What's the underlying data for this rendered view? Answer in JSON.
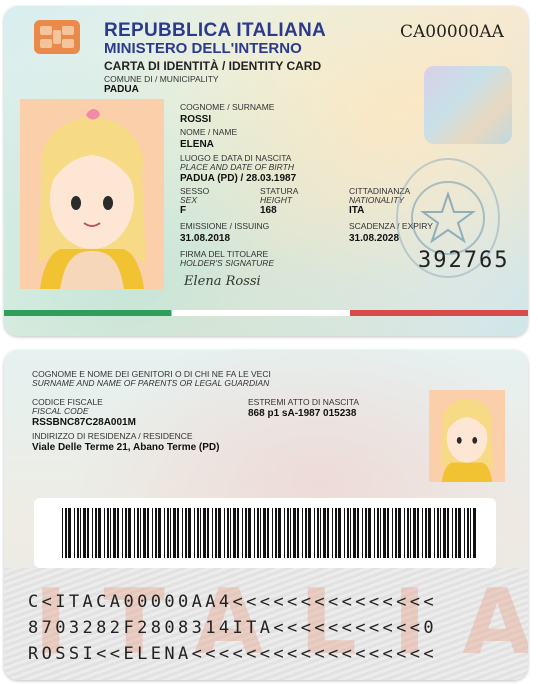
{
  "front": {
    "header_line1": "REPUBBLICA ITALIANA",
    "header_line2": "MINISTERO DELL'INTERNO",
    "header_line3": "CARTA DI IDENTITÀ / IDENTITY CARD",
    "document_number": "CA00000AA",
    "municipality_label": "COMUNE DI / MUNICIPALITY",
    "municipality": "PADUA",
    "surname_label": "COGNOME / SURNAME",
    "surname": "ROSSI",
    "name_label": "NOME / NAME",
    "name": "ELENA",
    "birth_label1": "LUOGO E DATA DI NASCITA",
    "birth_label2": "PLACE AND DATE OF BIRTH",
    "birth": "PADUA (PD) / 28.03.1987",
    "sex_label1": "SESSO",
    "sex_label2": "SEX",
    "sex": "F",
    "height_label1": "STATURA",
    "height_label2": "HEIGHT",
    "height": "168",
    "nationality_label1": "CITTADINANZA",
    "nationality_label2": "NATIONALITY",
    "nationality": "ITA",
    "issuing_label": "EMISSIONE / ISSUING",
    "issuing": "31.08.2018",
    "expiry_label": "SCADENZA / EXPIRY",
    "expiry": "31.08.2028",
    "signature_label1": "FIRMA DEL TITOLARE",
    "signature_label2": "HOLDER'S SIGNATURE",
    "signature": "Elena Rossi",
    "card_number": "392765"
  },
  "back": {
    "parents_label1": "COGNOME E NOME DEI GENITORI O DI CHI NE FA LE VECI",
    "parents_label2": "SURNAME AND NAME OF PARENTS OR LEGAL GUARDIAN",
    "fiscal_label1": "CODICE FISCALE",
    "fiscal_label2": "FISCAL CODE",
    "fiscal_code": "RSSBNC87C28A001M",
    "birth_record_label": "ESTREMI ATTO DI NASCITA",
    "birth_record": "868 p1 sA-1987 015238",
    "residence_label": "INDIRIZZO DI RESIDENZA / RESIDENCE",
    "residence": "Viale Delle Terme 21, Abano Terme (PD)",
    "watermark": "ITALIA",
    "mrz_line1": "C<ITACA00000AA4<<<<<<<<<<<<<<<",
    "mrz_line2": "8703282F2808314ITA<<<<<<<<<<<0",
    "mrz_line3": "ROSSI<<ELENA<<<<<<<<<<<<<<<<<<"
  },
  "colors": {
    "header_blue": "#2b3a8c",
    "chip": "#e98a4a",
    "photo_bg": "#fbcfa9"
  },
  "icons": {
    "chip": "chip-icon",
    "emblem": "emblem-icon",
    "avatar": "avatar-icon",
    "hologram": "hologram-icon"
  }
}
